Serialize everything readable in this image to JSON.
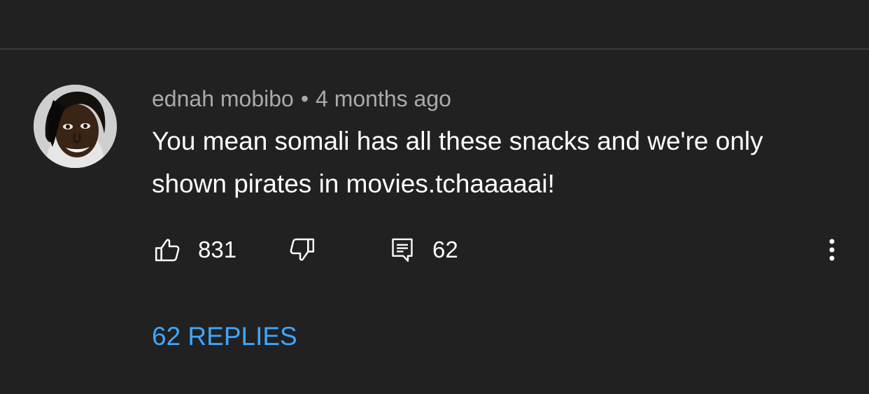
{
  "comment": {
    "author": "ednah mobibo",
    "separator": "•",
    "timestamp": "4 months ago",
    "text": "You mean somali has all these snacks and we're only shown pirates in movies.tchaaaaai!",
    "likes": "831",
    "replies_count": "62",
    "replies_link": "62 REPLIES"
  },
  "icons": {
    "like": "thumbs-up-icon",
    "dislike": "thumbs-down-icon",
    "reply": "comment-icon",
    "more": "more-vertical-icon"
  },
  "colors": {
    "background": "#212121",
    "divider": "#3a3a3a",
    "meta_text": "#aaaaaa",
    "body_text": "#ffffff",
    "link": "#3ea6ff"
  }
}
